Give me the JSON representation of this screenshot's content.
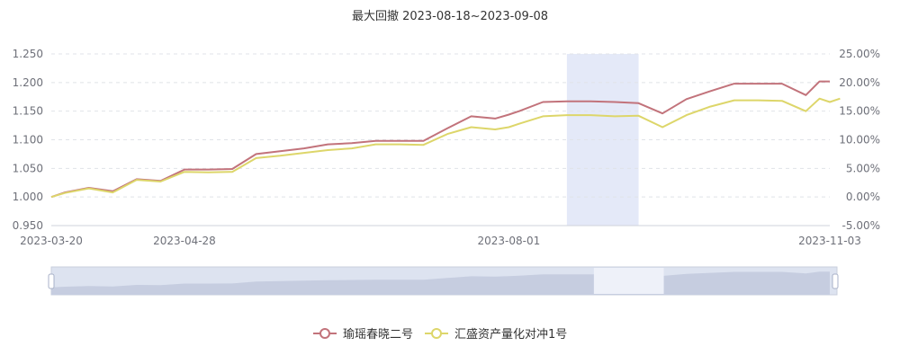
{
  "chart_data": {
    "type": "line",
    "title": "最大回撤   2023-08-18~2023-09-08",
    "x_ticks": [
      "2023-03-20",
      "2023-04-28",
      "2023-08-01",
      "2023-11-03"
    ],
    "x_range": [
      "2023-03-20",
      "2023-11-03"
    ],
    "y_left": {
      "ticks": [
        "0.950",
        "1.000",
        "1.050",
        "1.100",
        "1.150",
        "1.200",
        "1.250"
      ],
      "range": [
        0.95,
        1.25
      ]
    },
    "y_right": {
      "ticks": [
        "-5.00%",
        "0.00%",
        "5.00%",
        "10.00%",
        "15.00%",
        "20.00%",
        "25.00%"
      ],
      "range": [
        -5,
        25
      ]
    },
    "grid": true,
    "legend_position": "bottom-center",
    "highlight_band": {
      "start": "2023-08-18",
      "end": "2023-09-08",
      "color": "#e4e9f8"
    },
    "series": [
      {
        "name": "瑜瑶春晓二号",
        "color": "#c2737b",
        "points": [
          [
            "2023-03-20",
            1.0
          ],
          [
            "2023-03-24",
            1.008
          ],
          [
            "2023-03-31",
            1.016
          ],
          [
            "2023-04-07",
            1.01
          ],
          [
            "2023-04-14",
            1.031
          ],
          [
            "2023-04-21",
            1.028
          ],
          [
            "2023-04-28",
            1.048
          ],
          [
            "2023-05-05",
            1.048
          ],
          [
            "2023-05-12",
            1.049
          ],
          [
            "2023-05-19",
            1.075
          ],
          [
            "2023-05-26",
            1.08
          ],
          [
            "2023-06-02",
            1.085
          ],
          [
            "2023-06-09",
            1.092
          ],
          [
            "2023-06-16",
            1.094
          ],
          [
            "2023-06-23",
            1.098
          ],
          [
            "2023-06-30",
            1.098
          ],
          [
            "2023-07-07",
            1.098
          ],
          [
            "2023-07-14",
            1.12
          ],
          [
            "2023-07-21",
            1.141
          ],
          [
            "2023-07-28",
            1.137
          ],
          [
            "2023-08-01",
            1.144
          ],
          [
            "2023-08-04",
            1.15
          ],
          [
            "2023-08-11",
            1.166
          ],
          [
            "2023-08-18",
            1.167
          ],
          [
            "2023-08-25",
            1.167
          ],
          [
            "2023-09-01",
            1.166
          ],
          [
            "2023-09-08",
            1.164
          ],
          [
            "2023-09-15",
            1.146
          ],
          [
            "2023-09-22",
            1.171
          ],
          [
            "2023-09-29",
            1.185
          ],
          [
            "2023-10-06",
            1.198
          ],
          [
            "2023-10-13",
            1.198
          ],
          [
            "2023-10-20",
            1.198
          ],
          [
            "2023-10-27",
            1.178
          ],
          [
            "2023-10-31",
            1.202
          ],
          [
            "2023-11-03",
            1.202
          ]
        ]
      },
      {
        "name": "汇盛资产量化对冲1号",
        "color": "#ddd66a",
        "points": [
          [
            "2023-03-20",
            1.0
          ],
          [
            "2023-03-24",
            1.007
          ],
          [
            "2023-03-31",
            1.015
          ],
          [
            "2023-04-07",
            1.008
          ],
          [
            "2023-04-14",
            1.03
          ],
          [
            "2023-04-21",
            1.027
          ],
          [
            "2023-04-28",
            1.044
          ],
          [
            "2023-05-05",
            1.043
          ],
          [
            "2023-05-12",
            1.044
          ],
          [
            "2023-05-19",
            1.068
          ],
          [
            "2023-05-26",
            1.072
          ],
          [
            "2023-06-02",
            1.077
          ],
          [
            "2023-06-09",
            1.082
          ],
          [
            "2023-06-16",
            1.085
          ],
          [
            "2023-06-23",
            1.092
          ],
          [
            "2023-06-30",
            1.092
          ],
          [
            "2023-07-07",
            1.091
          ],
          [
            "2023-07-14",
            1.11
          ],
          [
            "2023-07-21",
            1.122
          ],
          [
            "2023-07-28",
            1.118
          ],
          [
            "2023-08-01",
            1.122
          ],
          [
            "2023-08-04",
            1.128
          ],
          [
            "2023-08-11",
            1.141
          ],
          [
            "2023-08-18",
            1.143
          ],
          [
            "2023-08-25",
            1.143
          ],
          [
            "2023-09-01",
            1.141
          ],
          [
            "2023-09-08",
            1.142
          ],
          [
            "2023-09-15",
            1.122
          ],
          [
            "2023-09-22",
            1.143
          ],
          [
            "2023-09-29",
            1.158
          ],
          [
            "2023-10-06",
            1.169
          ],
          [
            "2023-10-13",
            1.169
          ],
          [
            "2023-10-20",
            1.168
          ],
          [
            "2023-10-27",
            1.15
          ],
          [
            "2023-10-31",
            1.172
          ],
          [
            "2023-11-03",
            1.166
          ],
          [
            "2023-11-06",
            1.172
          ]
        ]
      }
    ]
  }
}
